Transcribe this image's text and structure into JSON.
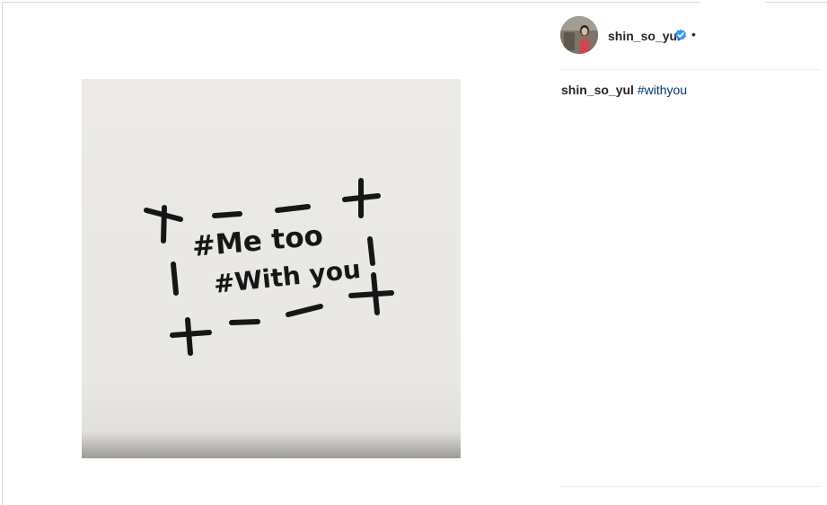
{
  "post": {
    "author": {
      "username": "shin_so_yul",
      "verified": true,
      "separator": "•"
    },
    "caption": {
      "username": "shin_so_yul",
      "hashtag": "#withyou"
    },
    "image": {
      "handwritten_text": [
        "#Me too",
        "#With you"
      ]
    }
  },
  "colors": {
    "link": "#00376b",
    "verified_badge": "#3897f0",
    "text": "#262626",
    "ink": "#161616",
    "paper": "#eae8e4"
  },
  "icons": {
    "verified": "verified-badge-icon"
  }
}
